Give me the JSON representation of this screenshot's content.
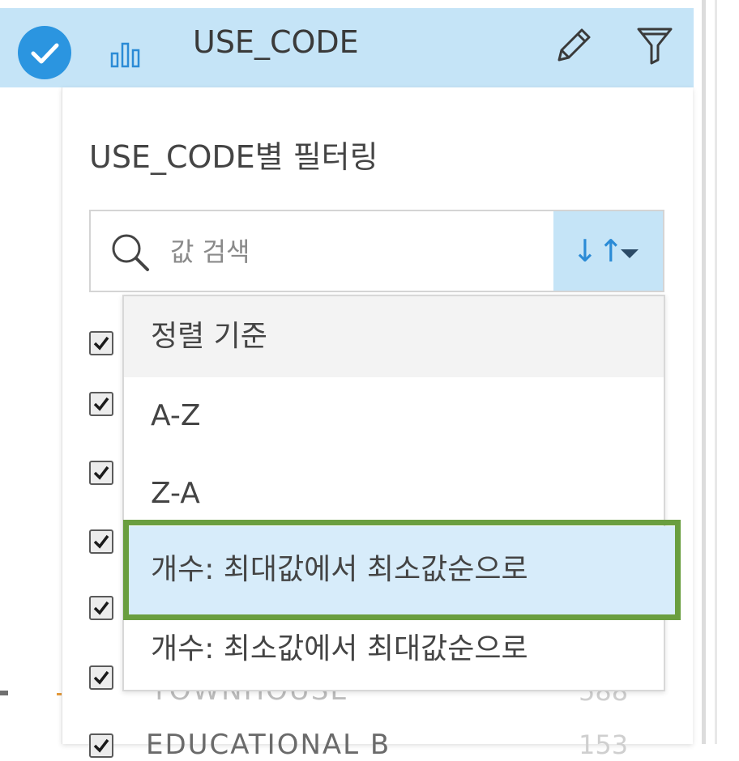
{
  "header": {
    "title": "USE_CODE"
  },
  "filter_panel": {
    "title": "USE_CODE별 필터링",
    "search": {
      "placeholder": "값 검색",
      "value": ""
    },
    "sort_button_symbol": "↓↑"
  },
  "sort_menu": {
    "header": "정렬 기준",
    "options": [
      {
        "label": "A-Z"
      },
      {
        "label": "Z-A"
      },
      {
        "label": "개수: 최대값에서 최소값순으로",
        "highlighted": true
      },
      {
        "label": "개수: 최소값에서 최대값순으로"
      }
    ]
  },
  "background_list": {
    "items": [
      {
        "label": "TOWNHOUSE",
        "count": "588"
      },
      {
        "label": "EDUCATIONAL B",
        "count": "153"
      }
    ]
  },
  "colors": {
    "header_bg": "#c5e4f7",
    "accent_blue": "#2b95e0",
    "highlight_bg": "#d7ecfa",
    "annotation_green": "#6a9e3f"
  }
}
